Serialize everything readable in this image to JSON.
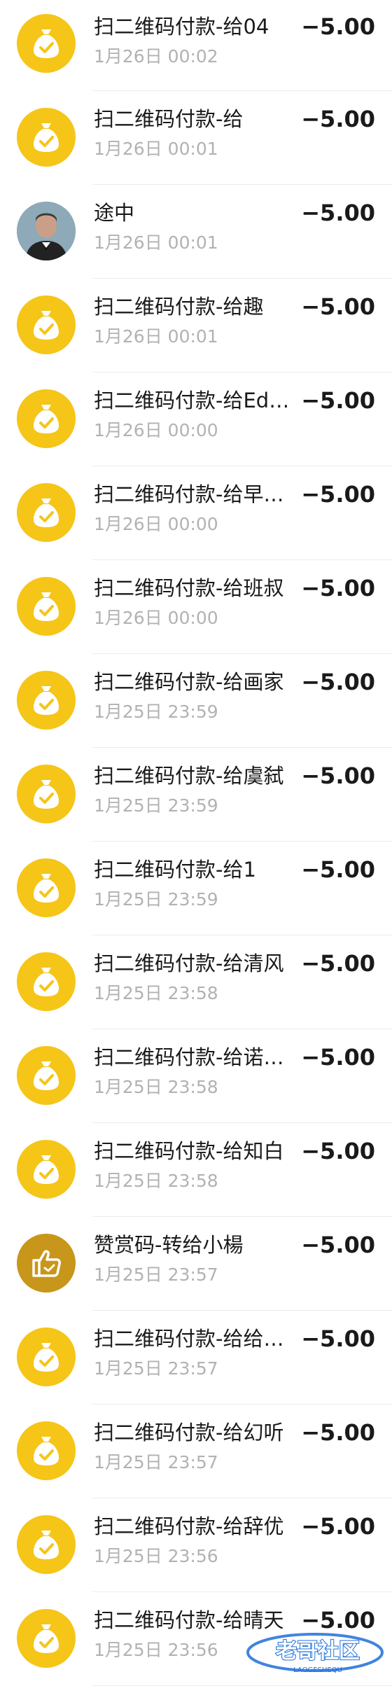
{
  "transactions": [
    {
      "title": "扫二维码付款-给04",
      "time": "1月26日 00:02",
      "amount": "−5.00",
      "icon": "money-bag-icon"
    },
    {
      "title": "扫二维码付款-给",
      "time": "1月26日 00:01",
      "amount": "−5.00",
      "icon": "money-bag-icon"
    },
    {
      "title": "途中",
      "time": "1月26日 00:01",
      "amount": "−5.00",
      "icon": "avatar-photo"
    },
    {
      "title": "扫二维码付款-给趣",
      "time": "1月26日 00:01",
      "amount": "−5.00",
      "icon": "money-bag-icon"
    },
    {
      "title": "扫二维码付款-给Ed…",
      "time": "1月26日 00:00",
      "amount": "−5.00",
      "icon": "money-bag-icon"
    },
    {
      "title": "扫二维码付款-给早…",
      "time": "1月26日 00:00",
      "amount": "−5.00",
      "icon": "money-bag-icon"
    },
    {
      "title": "扫二维码付款-给班叔",
      "time": "1月26日 00:00",
      "amount": "−5.00",
      "icon": "money-bag-icon"
    },
    {
      "title": "扫二维码付款-给画家",
      "time": "1月25日 23:59",
      "amount": "−5.00",
      "icon": "money-bag-icon"
    },
    {
      "title": "扫二维码付款-给虞弑",
      "time": "1月25日 23:59",
      "amount": "−5.00",
      "icon": "money-bag-icon"
    },
    {
      "title": "扫二维码付款-给1",
      "time": "1月25日 23:59",
      "amount": "−5.00",
      "icon": "money-bag-icon"
    },
    {
      "title": "扫二维码付款-给清风",
      "time": "1月25日 23:58",
      "amount": "−5.00",
      "icon": "money-bag-icon"
    },
    {
      "title": "扫二维码付款-给诺…",
      "time": "1月25日 23:58",
      "amount": "−5.00",
      "icon": "money-bag-icon"
    },
    {
      "title": "扫二维码付款-给知白",
      "time": "1月25日 23:58",
      "amount": "−5.00",
      "icon": "money-bag-icon"
    },
    {
      "title": "赞赏码-转给小楊",
      "time": "1月25日 23:57",
      "amount": "−5.00",
      "icon": "thumbs-up-icon"
    },
    {
      "title": "扫二维码付款-给给…",
      "time": "1月25日 23:57",
      "amount": "−5.00",
      "icon": "money-bag-icon"
    },
    {
      "title": "扫二维码付款-给幻听",
      "time": "1月25日 23:57",
      "amount": "−5.00",
      "icon": "money-bag-icon"
    },
    {
      "title": "扫二维码付款-给辞优",
      "time": "1月25日 23:56",
      "amount": "−5.00",
      "icon": "money-bag-icon"
    },
    {
      "title": "扫二维码付款-给晴天",
      "time": "1月25日 23:56",
      "amount": "−5.00",
      "icon": "money-bag-icon"
    }
  ],
  "watermark": {
    "main": "老哥社区",
    "sub": "LAOGESHEQU"
  },
  "colors": {
    "icon_yellow": "#f5c518",
    "icon_dark_gold": "#c8961a",
    "time_gray": "#b2b2b2",
    "watermark_blue": "#1e6fd9"
  }
}
